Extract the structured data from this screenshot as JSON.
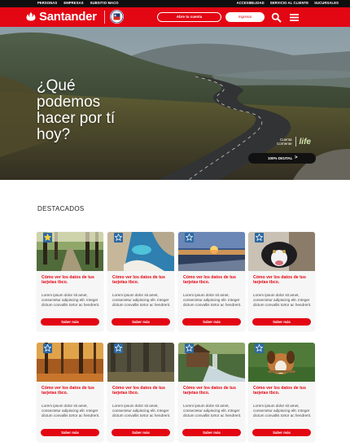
{
  "topbar": {
    "left_links": [
      "PERSONAS",
      "EMPRESAS",
      "SUBSITIO MACO"
    ],
    "right_links": [
      "ACCESIBILIDAD",
      "SERVICIO AL CLIENTE",
      "SUCURSALES"
    ]
  },
  "header": {
    "brand": "Santander",
    "open_account_label": "Abre tu cuenta",
    "login_label": "Ingresar",
    "colors": {
      "brand_red": "#e30613",
      "dark": "#0f0f10"
    }
  },
  "hero": {
    "title_lines": [
      "¿Qué",
      "podemos",
      "hacer por tí",
      "hoy?"
    ],
    "brand_caption_1": "Cuenta",
    "brand_caption_2": "Corriente",
    "brand_product": "life",
    "pill_label": "100% DIGITAL"
  },
  "section": {
    "title": "DESTACADOS"
  },
  "cards": [
    {
      "title": "Cómo ver los datos de tus tarjetas tbco.",
      "desc": "Lorem ipsum dolor sit amet, consectetur adipiscing elit. Integer dictum convallis tortor ac hendrerit.",
      "button": "Saber más",
      "image": "forest-path",
      "icon": "star-icon"
    },
    {
      "title": "Cómo ver los datos de tus tarjetas tbco.",
      "desc": "Lorem ipsum dolor sit amet, consectetur adipiscing elit. Integer dictum convallis tortor ac hendrerit.",
      "button": "Saber más",
      "image": "beach-cove",
      "icon": "star-outline-icon"
    },
    {
      "title": "Cómo ver los datos de tus tarjetas tbco.",
      "desc": "Lorem ipsum dolor sit amet, consectetur adipiscing elit. Integer dictum convallis tortor ac hendrerit.",
      "button": "Saber más",
      "image": "sunset-beach",
      "icon": "star-outline-icon"
    },
    {
      "title": "Cómo ver los datos de tus tarjetas tbco.",
      "desc": "Lorem ipsum dolor sit amet, consectetur adipiscing elit. Integer dictum convallis tortor ac hendrerit.",
      "button": "Saber más",
      "image": "dog-portrait",
      "icon": "star-outline-icon"
    },
    {
      "title": "Cómo ver los datos de tus tarjetas tbco.",
      "desc": "Lorem ipsum dolor sit amet, consectetur adipiscing elit. Integer dictum convallis tortor ac hendrerit.",
      "button": "Saber más",
      "image": "autumn-forest",
      "icon": "star-outline-icon"
    },
    {
      "title": "Cómo ver los datos de tus tarjetas tbco.",
      "desc": "Lorem ipsum dolor sit amet, consectetur adipiscing elit. Integer dictum convallis tortor ac hendrerit.",
      "button": "Saber más",
      "image": "dark-woods",
      "icon": "star-outline-icon"
    },
    {
      "title": "Cómo ver los datos de tus tarjetas tbco.",
      "desc": "Lorem ipsum dolor sit amet, consectetur adipiscing elit. Integer dictum convallis tortor ac hendrerit.",
      "button": "Saber más",
      "image": "mill-waterfall",
      "icon": "star-outline-icon"
    },
    {
      "title": "Cómo ver los datos de tus tarjetas tbco.",
      "desc": "Lorem ipsum dolor sit amet, consectetur adipiscing elit. Integer dictum convallis tortor ac hendrerit.",
      "button": "Saber más",
      "image": "dog-stick",
      "icon": "star-outline-icon"
    }
  ]
}
